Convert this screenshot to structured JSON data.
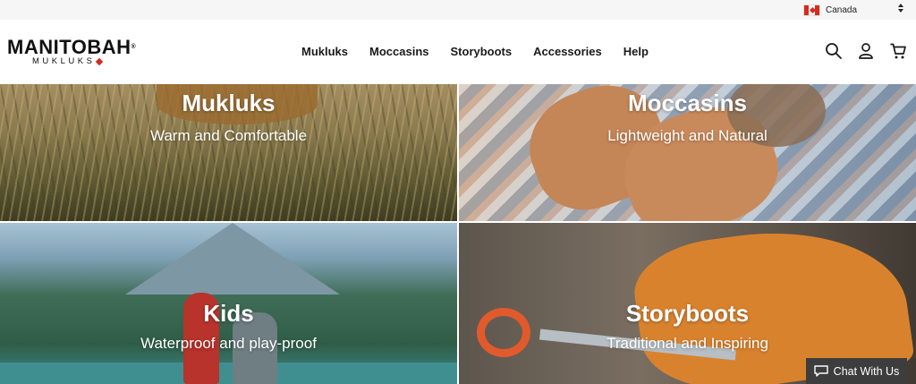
{
  "locale": {
    "country": "Canada"
  },
  "brand": {
    "name": "MANITOBAH",
    "tagline": "MUKLUKS",
    "reg_mark": "®"
  },
  "nav": [
    {
      "label": "Mukluks"
    },
    {
      "label": "Moccasins"
    },
    {
      "label": "Storyboots"
    },
    {
      "label": "Accessories"
    },
    {
      "label": "Help"
    }
  ],
  "icons": {
    "search": "search-icon",
    "account": "account-icon",
    "cart": "cart-icon"
  },
  "tiles": [
    {
      "title": "Mukluks",
      "subtitle": "Warm and Comfortable"
    },
    {
      "title": "Moccasins",
      "subtitle": "Lightweight and Natural"
    },
    {
      "title": "Kids",
      "subtitle": "Waterproof and play-proof"
    },
    {
      "title": "Storyboots",
      "subtitle": "Traditional and Inspiring"
    }
  ],
  "chat": {
    "label": "Chat With Us"
  },
  "colors": {
    "accent_red": "#d52b1e",
    "chat_bg": "#3d3d3d"
  }
}
